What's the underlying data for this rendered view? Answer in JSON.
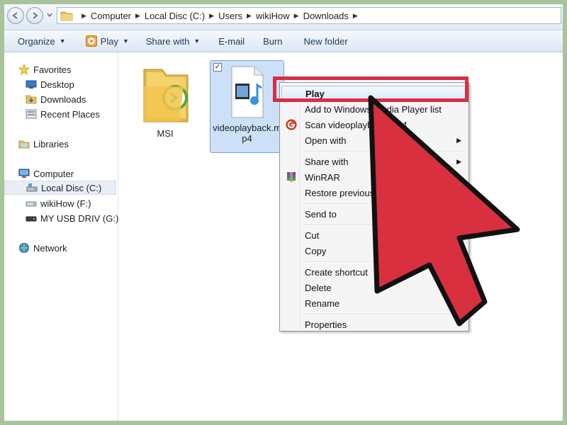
{
  "breadcrumb": [
    "Computer",
    "Local Disc (C:)",
    "Users",
    "wikiHow",
    "Downloads"
  ],
  "toolbar": {
    "organize": "Organize",
    "play": "Play",
    "share_with": "Share with",
    "email": "E-mail",
    "burn": "Burn",
    "new_folder": "New folder"
  },
  "sidebar": {
    "favorites": "Favorites",
    "desktop": "Desktop",
    "downloads": "Downloads",
    "recent_places": "Recent Places",
    "libraries": "Libraries",
    "computer": "Computer",
    "local_disc": "Local Disc (C:)",
    "wikihow_drive": "wikiHow (F:)",
    "usb_drive": "MY USB DRIV (G:)",
    "network": "Network"
  },
  "files": {
    "msi": "MSI",
    "video_line1": "videoplayback.m",
    "video_line2": "p4"
  },
  "context_menu": {
    "play": "Play",
    "add_to_wmp": "Add to Windows Media Player list",
    "scan": "Scan videoplayback.mp4",
    "open_with": "Open with",
    "share_with": "Share with",
    "winrar": "WinRAR",
    "restore": "Restore previous versions",
    "send_to": "Send to",
    "cut": "Cut",
    "copy": "Copy",
    "create_shortcut": "Create shortcut",
    "delete": "Delete",
    "rename": "Rename",
    "properties": "Properties"
  },
  "colors": {
    "highlight_red": "#d72f45",
    "cursor_red": "#d93040",
    "frame_green": "#a9c39a"
  }
}
